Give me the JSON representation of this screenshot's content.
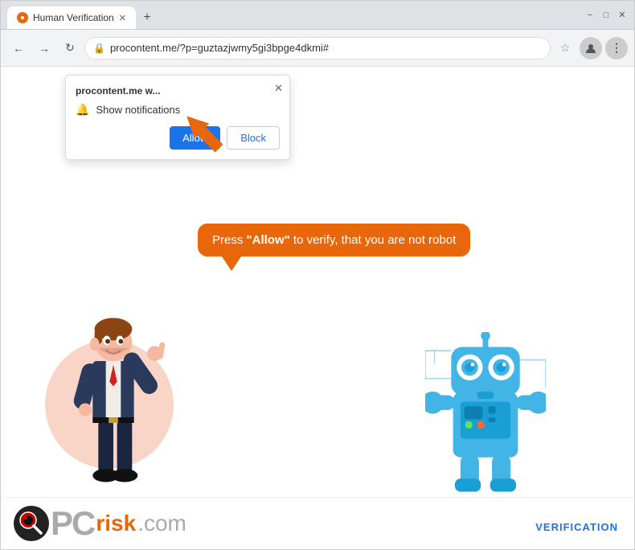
{
  "browser": {
    "tab_title": "Human Verification",
    "url": "procontent.me/?p=guztazjwmy5gi3bpge4dkmi#",
    "new_tab_label": "+",
    "close_label": "✕",
    "minimize_label": "−",
    "maximize_label": "□"
  },
  "nav": {
    "back": "←",
    "forward": "→",
    "refresh": "↻",
    "star": "☆"
  },
  "popup": {
    "site": "procontent.me w...",
    "notification_text": "Show notifications",
    "close": "✕",
    "allow_label": "Allow",
    "block_label": "Block"
  },
  "speech_bubble": {
    "text_pre": "Press ",
    "text_bold": "\"Allow\"",
    "text_post": " to verify, that you are not robot"
  },
  "pcrisk": {
    "pc_text": "PC",
    "risk_text": "risk",
    "dot_com": ".com",
    "verification": "VERIFICATION"
  }
}
